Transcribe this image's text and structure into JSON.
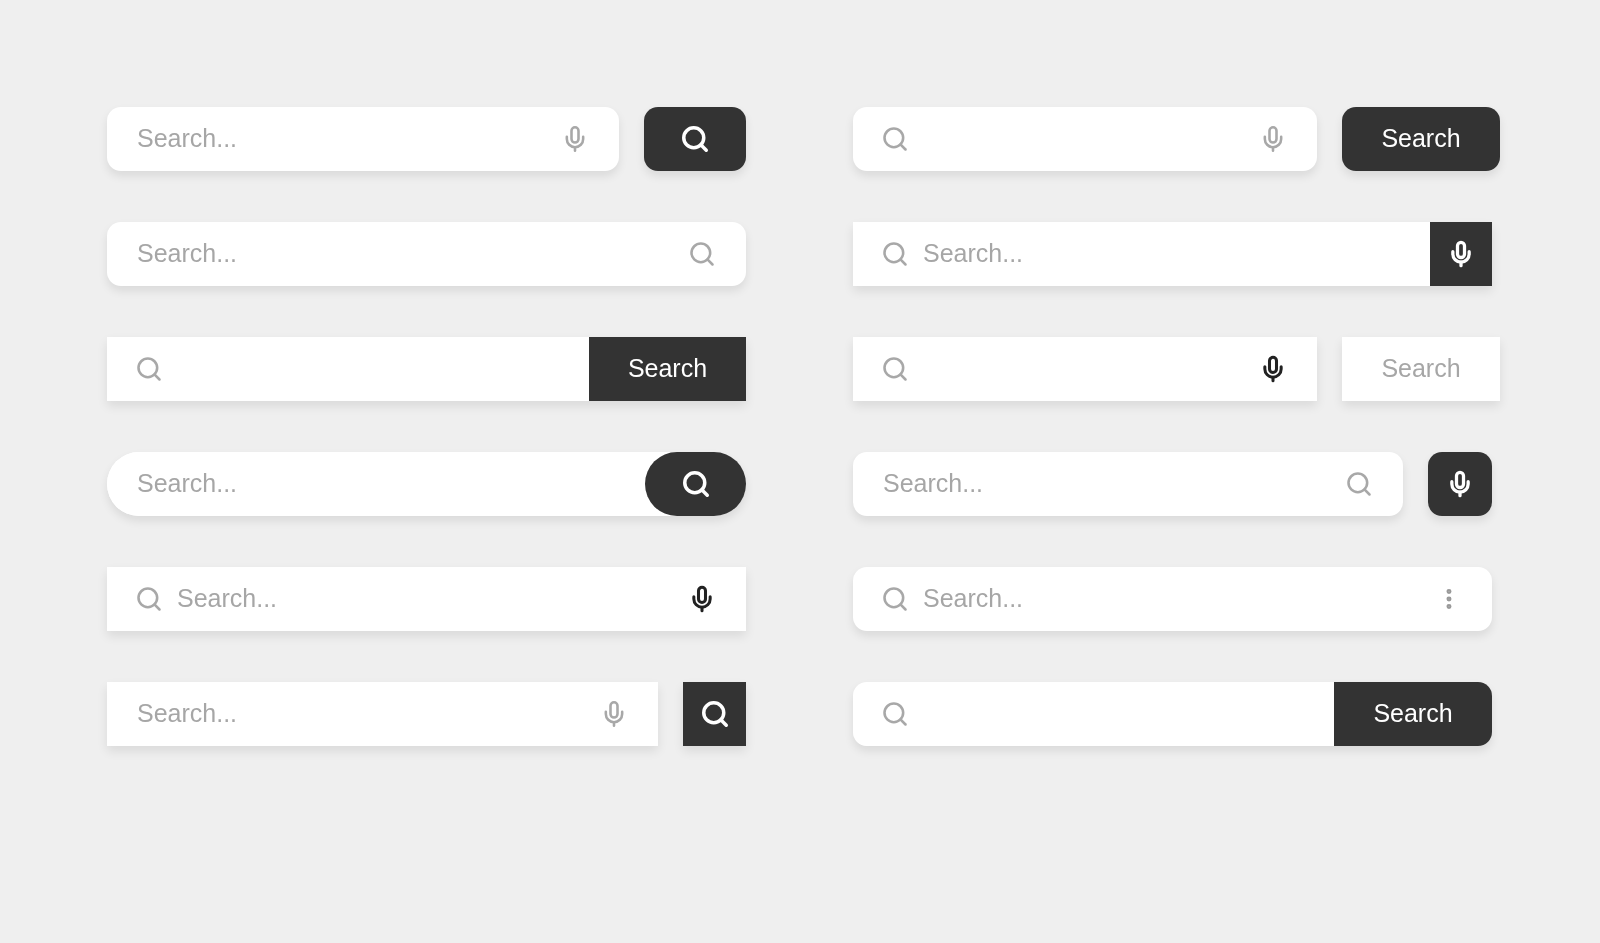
{
  "columns": [
    {
      "bars": [
        {
          "kind": "rounded-mic-separate-search",
          "placeholder": "Search..."
        },
        {
          "kind": "rounded-search-right",
          "placeholder": "Search..."
        },
        {
          "kind": "square-attached-label",
          "button": {
            "label": "Search"
          }
        },
        {
          "kind": "pill-attached-search",
          "placeholder": "Search..."
        },
        {
          "kind": "square-search-mic",
          "placeholder": "Search..."
        },
        {
          "kind": "square-mic-separate-search",
          "placeholder": "Search..."
        }
      ]
    },
    {
      "bars": [
        {
          "kind": "rounded-mic-separate-label",
          "button": {
            "label": "Search"
          }
        },
        {
          "kind": "square-attached-mic",
          "placeholder": "Search..."
        },
        {
          "kind": "square-mic-separate-outline-label",
          "button": {
            "label": "Search"
          }
        },
        {
          "kind": "rounded-search-separate-mic",
          "placeholder": "Search..."
        },
        {
          "kind": "rounded-menu",
          "placeholder": "Search..."
        },
        {
          "kind": "rounded-attached-label",
          "button": {
            "label": "Search"
          }
        }
      ]
    }
  ]
}
